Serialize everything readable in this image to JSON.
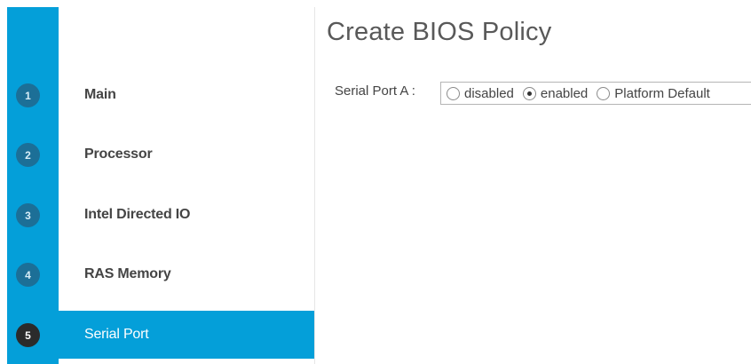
{
  "page": {
    "title": "Create BIOS Policy"
  },
  "steps": [
    {
      "num": "1",
      "label": "Main",
      "active": false
    },
    {
      "num": "2",
      "label": "Processor",
      "active": false
    },
    {
      "num": "3",
      "label": "Intel Directed IO",
      "active": false
    },
    {
      "num": "4",
      "label": "RAS Memory",
      "active": false
    },
    {
      "num": "5",
      "label": "Serial Port",
      "active": true
    }
  ],
  "serial_port_a": {
    "label": "Serial Port A :",
    "options": [
      "disabled",
      "enabled",
      "Platform Default"
    ],
    "selected": "enabled"
  },
  "colors": {
    "accent": "#049fd9",
    "step_badge": "#1c6f97",
    "active_badge": "#2b2b2b"
  },
  "icons": [
    "radio-unchecked-icon",
    "radio-checked-icon"
  ]
}
